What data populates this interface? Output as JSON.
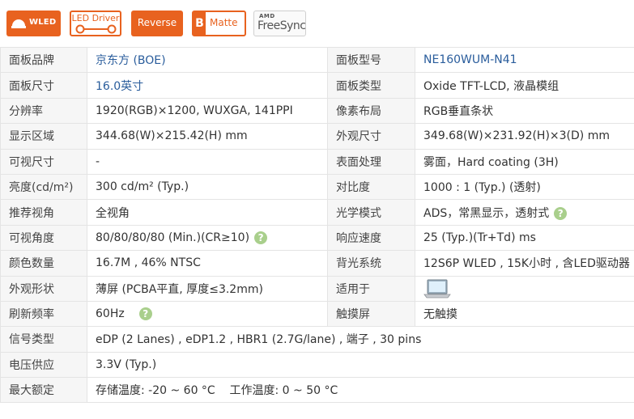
{
  "badges": {
    "wled": "WLED",
    "led_driver": "LED Driver",
    "reverse": "Reverse",
    "matte_letter": "B",
    "matte": "Matte",
    "amd": "AMD",
    "freesync": "FreeSync"
  },
  "colors": {
    "accent": "#e8621f",
    "help": "#a9cf8c",
    "label_bg": "#f6f6f6",
    "link": "#2a5d9c"
  },
  "specs": {
    "brand_label": "面板品牌",
    "brand_value": "京东方 (BOE)",
    "model_label": "面板型号",
    "model_value": "NE160WUM-N41",
    "size_label": "面板尺寸",
    "size_value": "16.0英寸",
    "type_label": "面板类型",
    "type_value": "Oxide TFT-LCD, 液晶模组",
    "resolution_label": "分辨率",
    "resolution_value": "1920(RGB)×1200, WUXGA, 141PPI",
    "pixel_label": "像素布局",
    "pixel_value": "RGB垂直条状",
    "active_label": "显示区域",
    "active_value": "344.68(W)×215.42(H) mm",
    "outline_label": "外观尺寸",
    "outline_value": "349.68(W)×231.92(H)×3(D) mm",
    "viewable_label": "可视尺寸",
    "viewable_value": "-",
    "surface_label": "表面处理",
    "surface_value": "雾面，Hard coating (3H)",
    "brightness_label": "亮度(cd/m²)",
    "brightness_value": "300 cd/m² (Typ.)",
    "contrast_label": "对比度",
    "contrast_value": "1000 : 1 (Typ.) (透射)",
    "viewdir_label": "推荐视角",
    "viewdir_value": "全视角",
    "mode_label": "光学模式",
    "mode_value": "ADS，常黑显示，透射式",
    "angle_label": "可视角度",
    "angle_value": "80/80/80/80 (Min.)(CR≥10)",
    "response_label": "响应速度",
    "response_value": "25 (Typ.)(Tr+Td) ms",
    "colors_label": "颜色数量",
    "colors_value": "16.7M , 46% NTSC",
    "backlight_label": "背光系统",
    "backlight_value": "12S6P WLED , 15K小时 , 含LED驱动器",
    "shape_label": "外观形状",
    "shape_value": "薄屏 (PCBA平直, 厚度≤3.2mm)",
    "app_label": "适用于",
    "app_icon": "laptop-icon",
    "refresh_label": "刷新频率",
    "refresh_value": "60Hz",
    "touch_label": "触摸屏",
    "touch_value": "无触摸",
    "signal_label": "信号类型",
    "signal_value": "eDP (2 Lanes) , eDP1.2 , HBR1 (2.7G/lane) , 端子 , 30 pins",
    "voltage_label": "电压供应",
    "voltage_value": "3.3V (Typ.)",
    "limits_label": "最大额定",
    "limits_value": "存储温度: -20 ~ 60 °C    工作温度: 0 ~ 50 °C",
    "help_glyph": "?"
  }
}
